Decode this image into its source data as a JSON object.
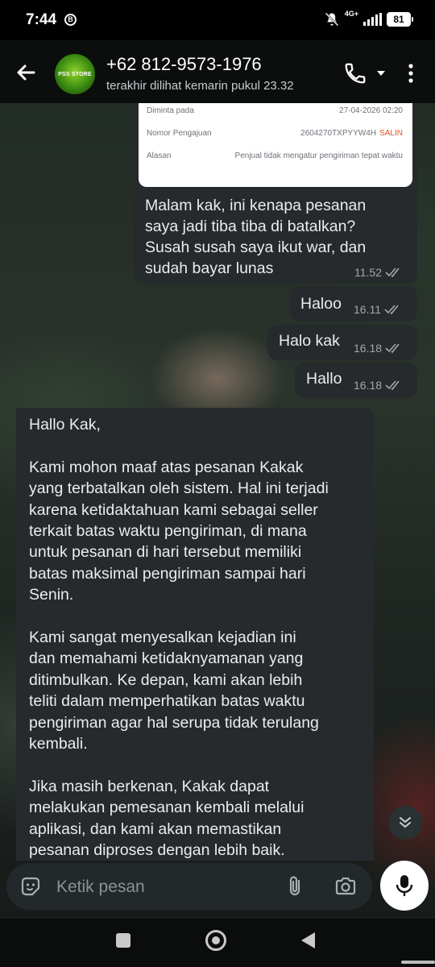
{
  "status_bar": {
    "time": "7:44",
    "badge": "B",
    "network": "4G+",
    "battery": "81"
  },
  "header": {
    "avatar_text": "PSS STORE",
    "contact_name": "+62 812-9573-1976",
    "last_seen": "terakhir dilihat kemarin pukul 23.32"
  },
  "order_card": {
    "rows": [
      {
        "label": "Diminta pada",
        "value": "27-04-2026 02:20"
      },
      {
        "label": "Nomor Pengajuan",
        "value": "2604270TXPYYW4H",
        "action": "SALIN"
      },
      {
        "label": "Alasan",
        "value": "Penjual tidak mengatur pengiriman tepat waktu"
      }
    ]
  },
  "messages": [
    {
      "direction": "out",
      "text": "Malam kak, ini kenapa pesanan\nsaya jadi tiba tiba di batalkan?\nSusah susah saya ikut war, dan\nsudah bayar lunas",
      "time": "11.52"
    },
    {
      "direction": "out",
      "text": "Haloo",
      "time": "16.11"
    },
    {
      "direction": "out",
      "text": "Halo kak",
      "time": "16.18"
    },
    {
      "direction": "out",
      "text": "Hallo",
      "time": "16.18"
    },
    {
      "direction": "in",
      "text": "Hallo Kak,\n\nKami mohon maaf atas pesanan Kakak\nyang terbatalkan oleh sistem. Hal ini terjadi\nkarena ketidaktahuan kami sebagai seller\nterkait batas waktu pengiriman, di mana\nuntuk pesanan di hari tersebut memiliki\nbatas maksimal pengiriman sampai hari\nSenin.\n\nKami sangat menyesalkan kejadian ini\ndan memahami ketidaknyamanan yang\nditimbulkan. Ke depan, kami akan lebih\nteliti dalam memperhatikan batas waktu\npengiriman agar hal serupa tidak terulang\nkembali.\n\nJika masih berkenan, Kakak dapat\nmelakukan pemesanan kembali melalui\naplikasi, dan kami akan memastikan\npesanan diproses dengan lebih baik."
    }
  ],
  "input": {
    "placeholder": "Ketik pesan"
  },
  "colors": {
    "bubble": "#262a2d",
    "tick_read": "#a3a8ad",
    "salin": "#e0531f"
  }
}
